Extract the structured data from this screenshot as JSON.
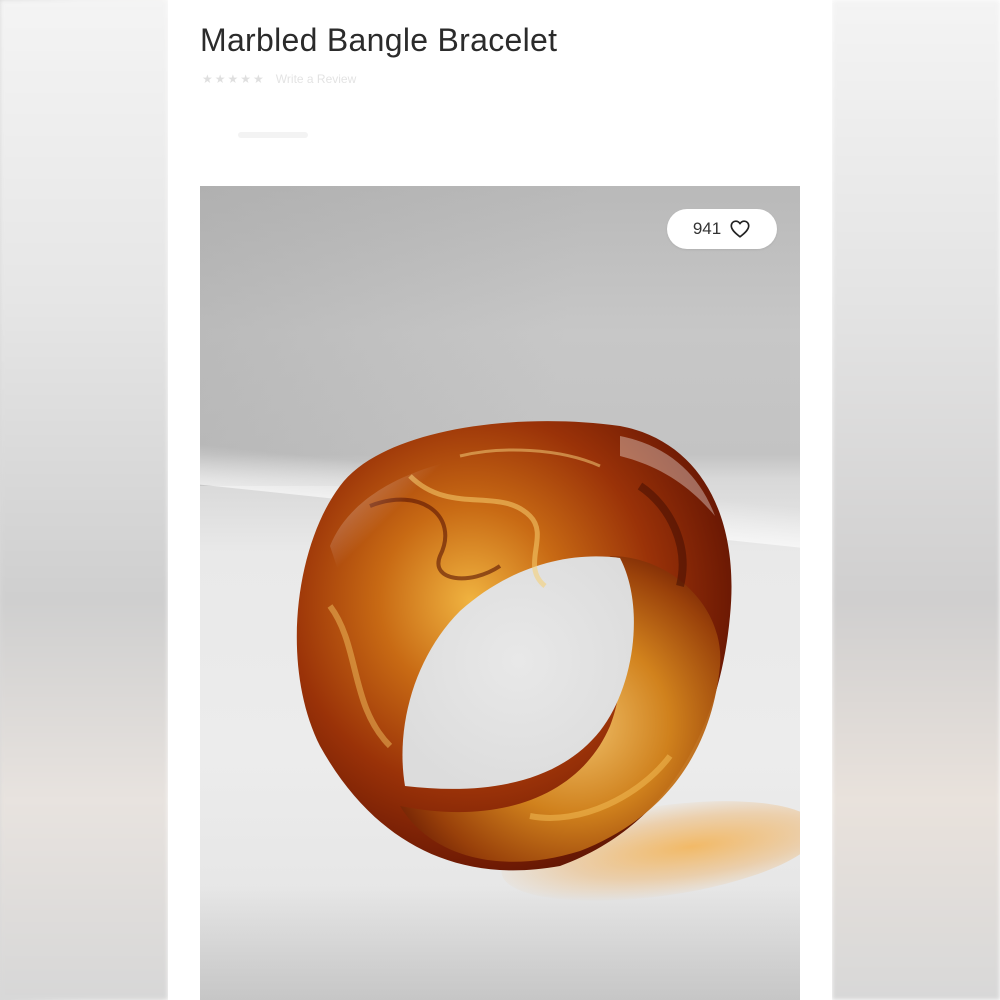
{
  "product": {
    "title": "Marbled Bangle Bracelet",
    "rating_text": "Write a Review"
  },
  "photo": {
    "likes_count": "941",
    "like_icon": "heart-outline-icon"
  },
  "colors": {
    "amber": "#d9821a",
    "dark_tortoise": "#6b1a05",
    "background": "#ffffff"
  }
}
